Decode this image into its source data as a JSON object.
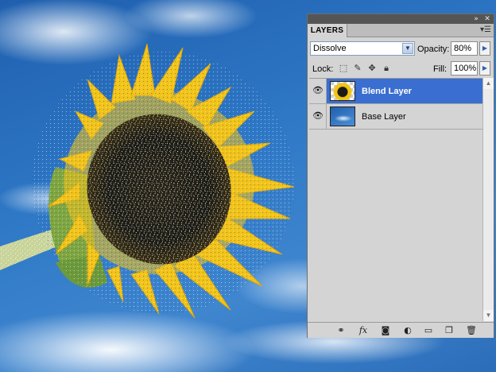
{
  "panel": {
    "tab_label": "LAYERS",
    "collapse_icon": "double-chevron-right-icon",
    "close_icon": "close-icon",
    "menu_icon": "panel-menu-icon"
  },
  "blend": {
    "mode": "Dissolve",
    "opacity_label": "Opacity:",
    "opacity_value": "80%"
  },
  "lock": {
    "label": "Lock:",
    "icons": [
      "lock-transparent-pixels-icon",
      "lock-image-pixels-icon",
      "lock-position-icon",
      "lock-all-icon"
    ],
    "fill_label": "Fill:",
    "fill_value": "100%"
  },
  "layers": [
    {
      "name": "Blend Layer",
      "selected": true,
      "visible": true
    },
    {
      "name": "Base Layer",
      "selected": false,
      "visible": true
    }
  ],
  "bottom_icons": [
    "link-layers-icon",
    "layer-style-fx-icon",
    "layer-mask-icon",
    "adjustment-layer-icon",
    "new-group-folder-icon",
    "new-layer-icon",
    "trash-icon"
  ],
  "colors": {
    "selection": "#3a6ed0",
    "sky": "#2e78c6",
    "petal": "#f2c418"
  }
}
